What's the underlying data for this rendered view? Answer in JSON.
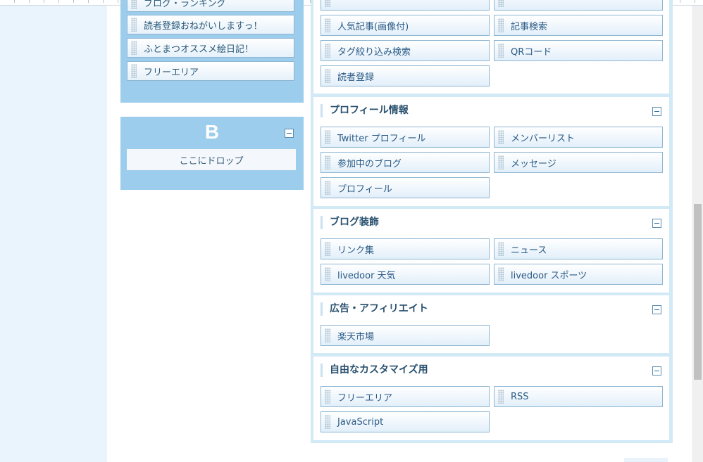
{
  "sidebar_a": {
    "items": [
      {
        "label": "ブログ・ランキング"
      },
      {
        "label": "読者登録おねがいしますっ！"
      },
      {
        "label": "ふとまつオススメ絵日記！"
      },
      {
        "label": "フリーエリア"
      }
    ]
  },
  "sidebar_b": {
    "title": "B",
    "drop_label": "ここにドロップ"
  },
  "top_group": {
    "widgets": [
      {
        "label": "人気記事(画像付)"
      },
      {
        "label": "記事検索"
      },
      {
        "label": "タグ絞り込み検索"
      },
      {
        "label": "QRコード"
      },
      {
        "label": "読者登録"
      }
    ]
  },
  "groups": {
    "profile": {
      "title": "プロフィール情報",
      "widgets": [
        {
          "label": "Twitter プロフィール"
        },
        {
          "label": "メンバーリスト"
        },
        {
          "label": "参加中のブログ"
        },
        {
          "label": "メッセージ"
        },
        {
          "label": "プロフィール"
        }
      ]
    },
    "decoration": {
      "title": "ブログ装飾",
      "widgets": [
        {
          "label": "リンク集"
        },
        {
          "label": "ニュース"
        },
        {
          "label": "livedoor 天気"
        },
        {
          "label": "livedoor スポーツ"
        }
      ]
    },
    "ads": {
      "title": "広告・アフィリエイト",
      "widgets": [
        {
          "label": "楽天市場"
        }
      ]
    },
    "custom": {
      "title": "自由なカスタマイズ用",
      "widgets": [
        {
          "label": "フリーエリア"
        },
        {
          "label": "RSS"
        },
        {
          "label": "JavaScript"
        }
      ]
    }
  },
  "colors": {
    "sidebar_bg": "#9ccdec",
    "page_bg": "#eaf4fd",
    "group_border": "#d2e9f6",
    "widget_text": "#2a5a85"
  },
  "icons": [
    "grip-icon",
    "minus-icon"
  ]
}
